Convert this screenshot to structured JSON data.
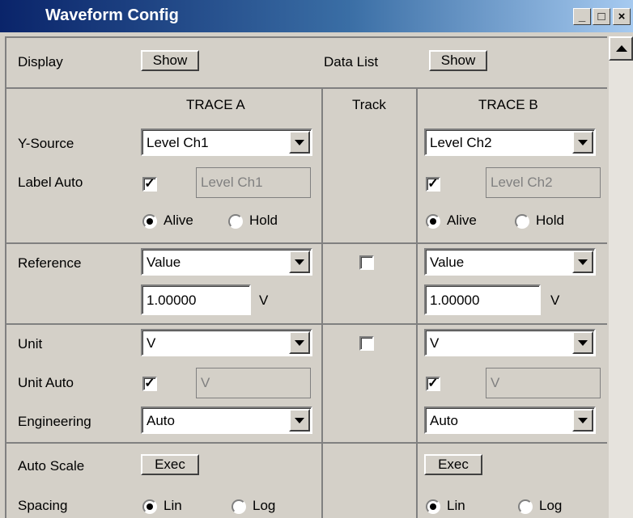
{
  "window": {
    "title": "Waveform Config"
  },
  "titlebar_buttons": {
    "minimize": "_",
    "maximize": "□",
    "close": "×"
  },
  "row_display": {
    "display_label": "Display",
    "display_button": "Show",
    "datalist_label": "Data List",
    "datalist_button": "Show"
  },
  "columns": {
    "trace_a": "TRACE A",
    "track": "Track",
    "trace_b": "TRACE B"
  },
  "labels": {
    "y_source": "Y-Source",
    "label_auto": "Label Auto",
    "reference": "Reference",
    "unit": "Unit",
    "unit_auto": "Unit Auto",
    "engineering": "Engineering",
    "auto_scale": "Auto Scale",
    "spacing": "Spacing"
  },
  "trace_a": {
    "y_source": "Level Ch1",
    "label_auto_checked": true,
    "label_text": "Level Ch1",
    "mode_alive": "Alive",
    "mode_hold": "Hold",
    "reference": "Value",
    "reference_value": "1.00000",
    "reference_unit": "V",
    "unit": "V",
    "unit_auto_checked": true,
    "unit_text": "V",
    "engineering": "Auto",
    "auto_scale_button": "Exec",
    "spacing_lin": "Lin",
    "spacing_log": "Log"
  },
  "trace_b": {
    "y_source": "Level Ch2",
    "label_auto_checked": true,
    "label_text": "Level Ch2",
    "mode_alive": "Alive",
    "mode_hold": "Hold",
    "reference": "Value",
    "reference_value": "1.00000",
    "reference_unit": "V",
    "unit": "V",
    "unit_auto_checked": true,
    "unit_text": "V",
    "engineering": "Auto",
    "auto_scale_button": "Exec",
    "spacing_lin": "Lin",
    "spacing_log": "Log"
  },
  "check_mark": "✓"
}
